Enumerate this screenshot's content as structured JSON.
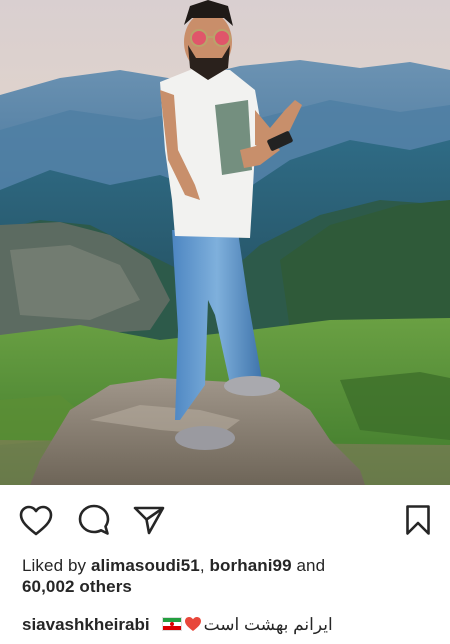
{
  "post": {
    "photo_alt": "",
    "actions": {
      "like_icon": "heart-icon",
      "comment_icon": "comment-icon",
      "share_icon": "paper-plane-icon",
      "save_icon": "bookmark-icon"
    },
    "likes": {
      "prefix": "Liked by ",
      "user1": "alimasoudi51",
      "separator": ", ",
      "user2": "borhani99",
      "and": " and",
      "count": "60,002 others"
    },
    "caption": {
      "username": "siavashkheirabi",
      "text": "ایرانم بهشت است",
      "emoji_heart": "heart-emoji",
      "emoji_flag": "iran-flag-emoji"
    }
  },
  "colors": {
    "text": "#262626",
    "heart_emoji": "#e8473b",
    "background": "#ffffff"
  }
}
